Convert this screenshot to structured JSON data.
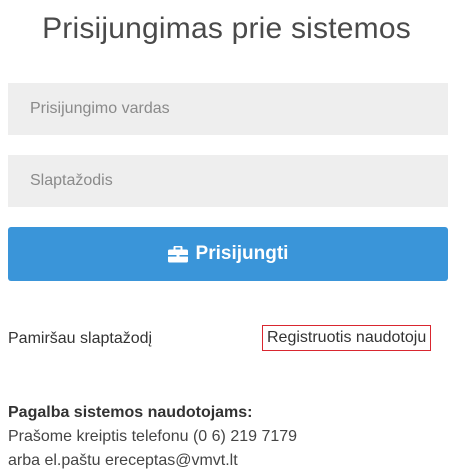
{
  "header": {
    "title": "Prisijungimas prie sistemos"
  },
  "form": {
    "username_placeholder": "Prisijungimo vardas",
    "password_placeholder": "Slaptažodis",
    "login_label": "Prisijungti",
    "login_icon": "briefcase-icon",
    "accent_color": "#3a95d9"
  },
  "links": {
    "forgot_password": "Pamiršau slaptažodį",
    "register": "Registruotis naudotoju",
    "register_border_color": "#d9262f"
  },
  "help": {
    "title": "Pagalba sistemos naudotojams:",
    "line1": "Prašome kreiptis telefonu (0 6) 219 7179",
    "line2": "arba el.paštu ereceptas@vmvt.lt"
  }
}
